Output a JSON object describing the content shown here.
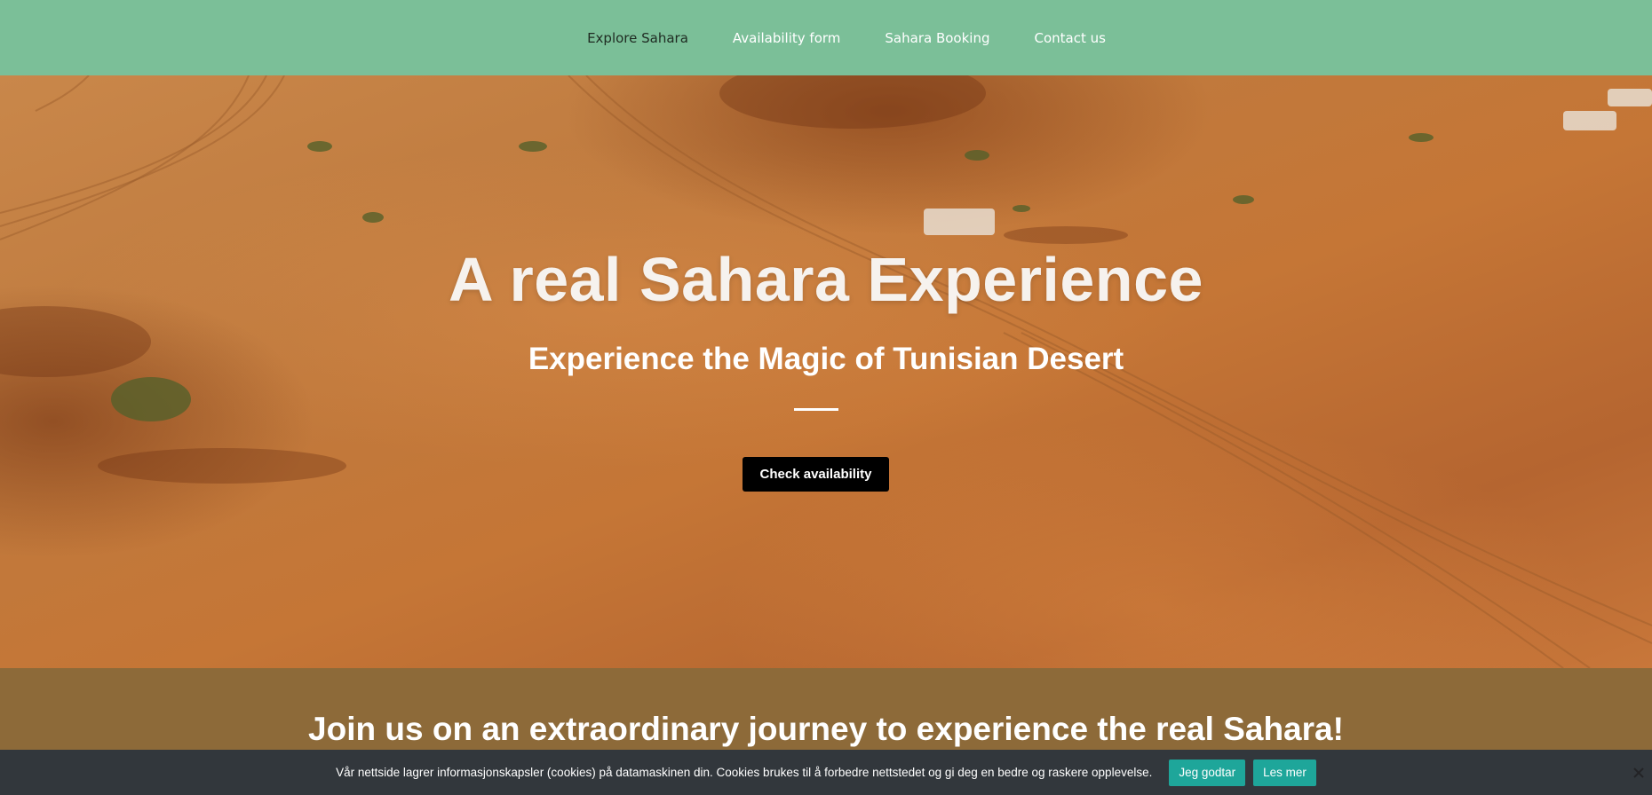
{
  "nav": {
    "items": [
      {
        "label": "Explore Sahara",
        "active": true
      },
      {
        "label": "Availability form",
        "active": false
      },
      {
        "label": "Sahara Booking",
        "active": false
      },
      {
        "label": "Contact us",
        "active": false
      }
    ]
  },
  "hero": {
    "title": "A real Sahara Experience",
    "subtitle": "Experience the Magic of Tunisian Desert",
    "cta_label": "Check availability"
  },
  "journey": {
    "heading": "Join us on an extraordinary journey to experience the real Sahara!"
  },
  "cookie": {
    "text": "Vår nettside lagrer informasjonskapsler (cookies) på datamaskinen din. Cookies brukes til å forbedre nettstedet og gi deg en bedre og raskere opplevelse.",
    "accept_label": "Jeg godtar",
    "more_label": "Les mer",
    "close_icon": "close-icon"
  },
  "colors": {
    "nav_bg": "#7bbf98",
    "journey_bg": "#8d6a39",
    "cookie_bg": "#32373c",
    "cookie_button": "#1ea69a",
    "cta_bg": "#000000"
  }
}
